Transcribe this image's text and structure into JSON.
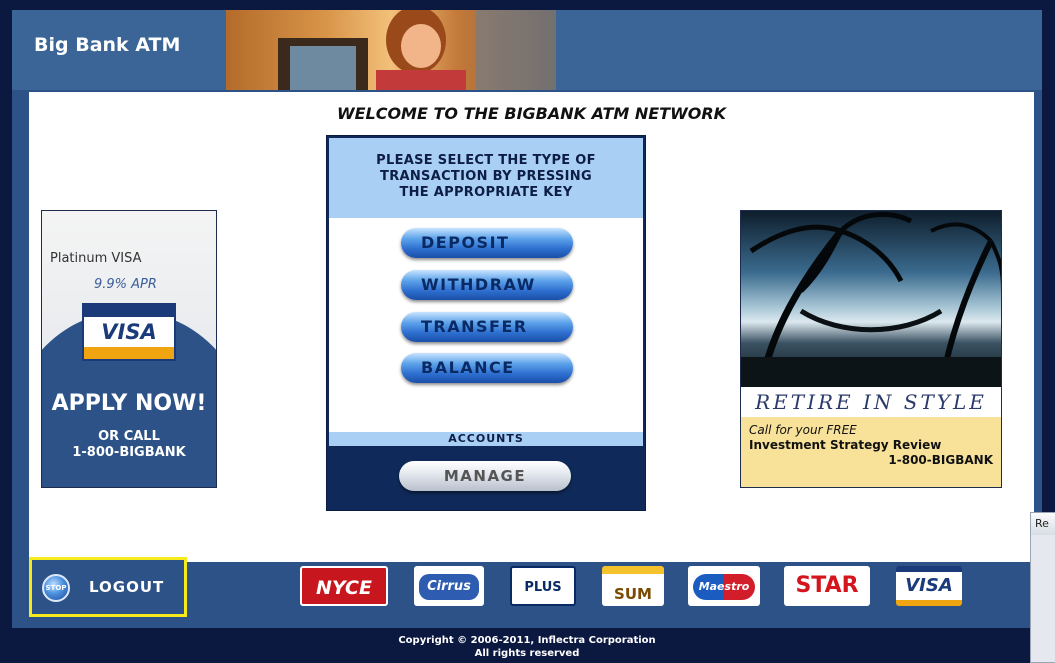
{
  "header": {
    "title": "Big Bank ATM"
  },
  "main": {
    "welcome": "WELCOME TO THE BIGBANK ATM NETWORK",
    "instructions": [
      "PLEASE SELECT THE TYPE OF",
      "TRANSACTION BY PRESSING",
      "THE APPROPRIATE KEY"
    ],
    "transactions": [
      "DEPOSIT",
      "WITHDRAW",
      "TRANSFER",
      "BALANCE"
    ],
    "accounts_label": "ACCOUNTS",
    "manage_label": "MANAGE"
  },
  "ads": {
    "visa": {
      "line1": "Platinum VISA",
      "line2": "9.9% APR",
      "card": "VISA",
      "apply": "APPLY NOW!",
      "call1": "OR CALL",
      "call2": "1-800-BIGBANK"
    },
    "retire": {
      "title": "RETIRE IN STYLE",
      "line1": "Call for your FREE",
      "line2": "Investment Strategy Review",
      "line3": "1-800-BIGBANK"
    }
  },
  "footer": {
    "logout_label": "LOGOUT",
    "stop_text": "STOP",
    "logos": [
      "NYCE",
      "Cirrus",
      "PLUS",
      "SUM",
      "Maestro",
      "STAR",
      "VISA"
    ],
    "copyright": "Copyright © 2006-2011, Inflectra Corporation",
    "rights": "All rights reserved"
  },
  "side_window": {
    "title": "Re"
  },
  "colors": {
    "banner": "#3a6596",
    "frame": "#2c5287",
    "logout_highlight": "#f4ea1c"
  }
}
